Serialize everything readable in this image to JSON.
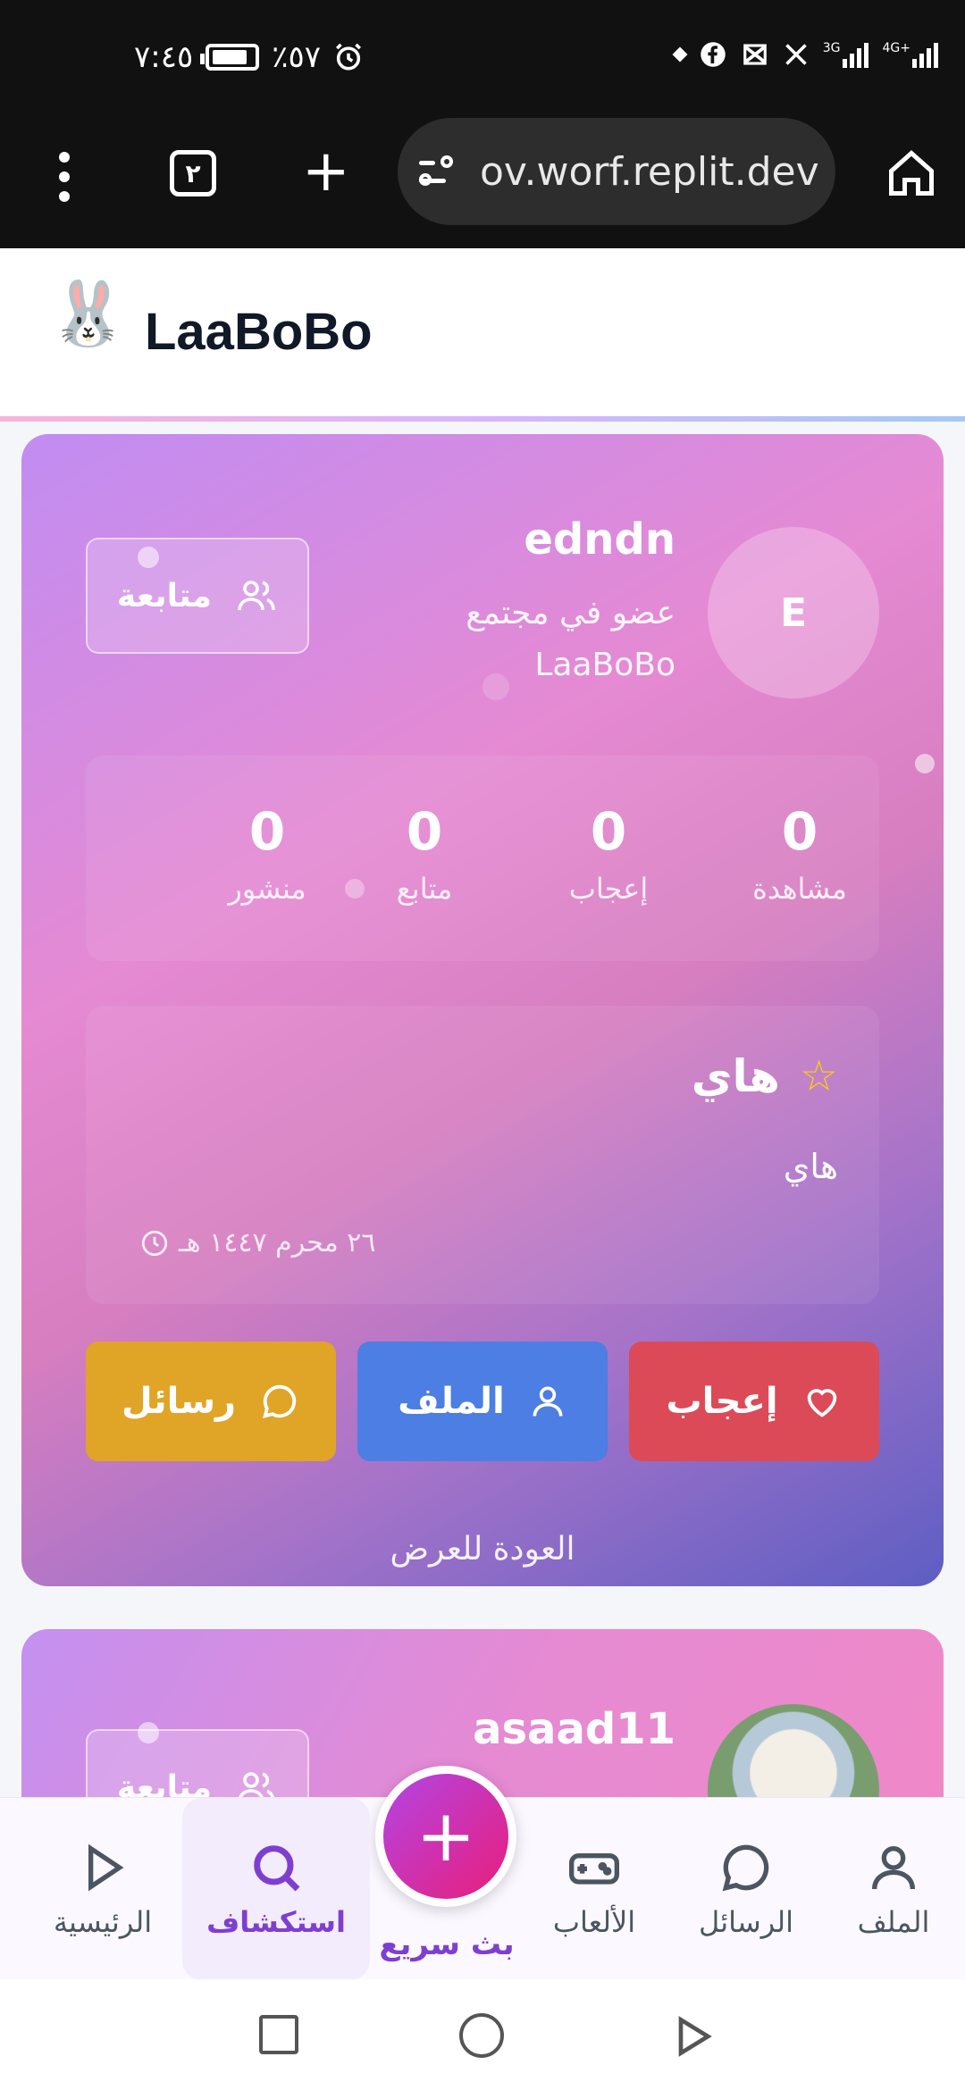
{
  "status_bar": {
    "time": "٧:٤٥",
    "battery": "٪٥٧",
    "network_3g": "3G",
    "network_4g": "4G+"
  },
  "browser": {
    "tab_count": "٢",
    "url": "ov.worf.replit.dev"
  },
  "app": {
    "brand": "LaaBoBo",
    "logo_icon": "🐰"
  },
  "profile_card": {
    "avatar_letter": "E",
    "username": "edndn",
    "bio": "عضو في مجتمع LaaBoBo",
    "follow_label": "متابعة",
    "stats": [
      {
        "value": "0",
        "label": "مشاهدة"
      },
      {
        "value": "0",
        "label": "إعجاب"
      },
      {
        "value": "0",
        "label": "متابع"
      },
      {
        "value": "0",
        "label": "منشور"
      }
    ],
    "post": {
      "title": "هاي",
      "body": "هاي",
      "date": "٢٦ محرم ١٤٤٧ هـ"
    },
    "actions": {
      "like": "إعجاب",
      "profile": "الملف",
      "messages": "رسائل"
    },
    "back_link": "العودة للعرض"
  },
  "profile_card_2": {
    "username": "asaad11",
    "follow_label": "متابعة"
  },
  "bottom_nav": {
    "items": [
      {
        "label": "الملف",
        "icon": "user-icon"
      },
      {
        "label": "الرسائل",
        "icon": "chat-icon"
      },
      {
        "label": "الألعاب",
        "icon": "gamepad-icon"
      },
      {
        "label": "بث سريع",
        "icon": "plus-icon"
      },
      {
        "label": "استكشاف",
        "icon": "search-icon"
      },
      {
        "label": "الرئيسية",
        "icon": "play-icon"
      }
    ],
    "active": "استكشاف"
  },
  "colors": {
    "like": "#dc4a57",
    "profile": "#4c7ee3",
    "messages": "#e0a427",
    "accent": "#7e3fd1"
  }
}
